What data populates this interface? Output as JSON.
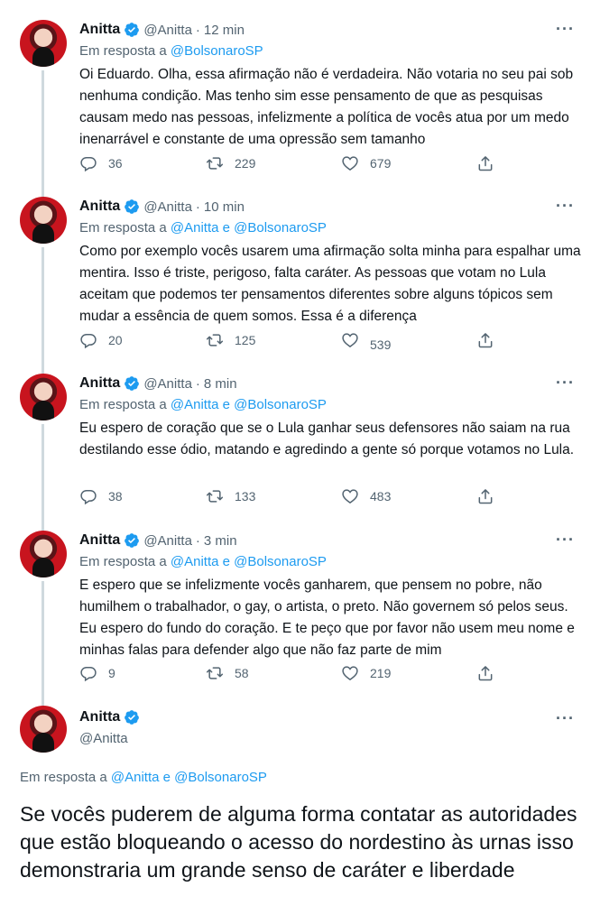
{
  "tweets": [
    {
      "name": "Anitta",
      "handle": "@Anitta",
      "dot": "·",
      "time": "12 min",
      "reply_prefix": "Em resposta a",
      "reply_to": "@BolsonaroSP",
      "text": "Oi Eduardo. Olha, essa afirmação não é verdadeira. Não votaria no seu pai sob nenhuma condição. Mas tenho sim esse pensamento de que as pesquisas causam medo nas pessoas, infelizmente a política de vocês atua por um medo inenarrável e constante de uma opressão sem tamanho",
      "replies": "36",
      "retweets": "229",
      "likes": "679"
    },
    {
      "name": "Anitta",
      "handle": "@Anitta",
      "dot": "·",
      "time": "10 min",
      "reply_prefix": "Em resposta a",
      "reply_to": "@Anitta e @BolsonaroSP",
      "text": "Como por exemplo vocês usarem uma afirmação solta minha para espalhar uma mentira. Isso é triste, perigoso, falta caráter. As pessoas que votam no Lula aceitam que podemos ter pensamentos diferentes sobre alguns tópicos sem mudar a essência de quem somos. Essa é a diferença",
      "replies": "20",
      "retweets": "125",
      "likes": "539"
    },
    {
      "name": "Anitta",
      "handle": "@Anitta",
      "dot": "·",
      "time": "8 min",
      "reply_prefix": "Em resposta a",
      "reply_to": "@Anitta e @BolsonaroSP",
      "text": "Eu espero de coração que se o Lula ganhar seus defensores não saiam na rua destilando esse ódio, matando e agredindo a gente só porque votamos no Lula.",
      "replies": "38",
      "retweets": "133",
      "likes": "483"
    },
    {
      "name": "Anitta",
      "handle": "@Anitta",
      "dot": "·",
      "time": "3 min",
      "reply_prefix": "Em resposta a",
      "reply_to": "@Anitta e @BolsonaroSP",
      "text": "E espero que se infelizmente vocês ganharem, que pensem no pobre, não humilhem o trabalhador, o gay, o artista, o preto. Não governem só pelos seus. Eu espero do fundo do coração. E te peço que por favor não usem meu nome e minhas falas para defender algo que não faz parte de mim",
      "replies": "9",
      "retweets": "58",
      "likes": "219"
    }
  ],
  "main_tweet": {
    "name": "Anitta",
    "handle": "@Anitta",
    "reply_prefix": "Em resposta a",
    "reply_to": "@Anitta e @BolsonaroSP",
    "text": "Se vocês puderem de alguma forma contatar as autoridades que estão bloqueando o acesso do nordestino às urnas isso demonstraria um grande senso de caráter e liberdade"
  },
  "more_label": "···",
  "colors": {
    "accent": "#1d9bf0",
    "secondary_text": "#536471",
    "thread_line": "#cfd9de"
  },
  "icons": [
    "verified-badge-icon",
    "reply-icon",
    "retweet-icon",
    "like-icon",
    "share-icon",
    "more-icon"
  ]
}
